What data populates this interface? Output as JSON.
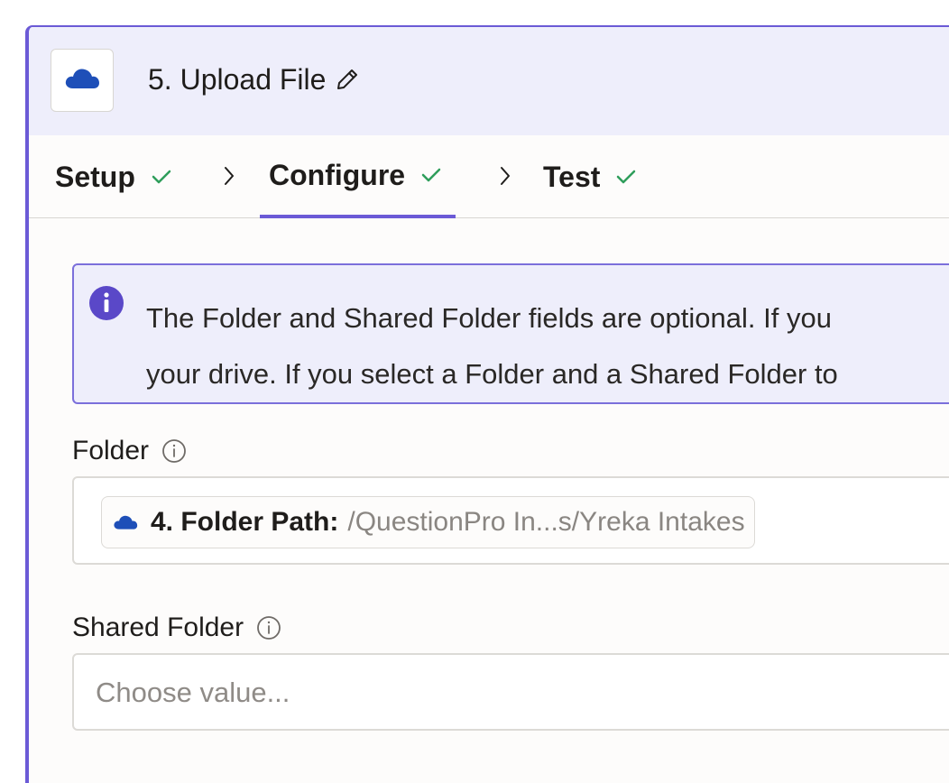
{
  "header": {
    "app_icon": "onedrive-cloud-icon",
    "step_title": "5. Upload File",
    "edit_icon": "pencil-icon"
  },
  "tabs": [
    {
      "label": "Setup",
      "status": "complete",
      "active": false
    },
    {
      "label": "Configure",
      "status": "complete",
      "active": true
    },
    {
      "label": "Test",
      "status": "complete",
      "active": false
    }
  ],
  "info_banner": {
    "icon": "info-circle-icon",
    "line1": "The Folder and Shared Folder fields are optional. If you",
    "line2": "your drive. If you select a Folder and a Shared Folder to"
  },
  "fields": {
    "folder": {
      "label": "Folder",
      "value_step": "4. Folder Path:",
      "value_text": "/QuestionPro In...s/Yreka Intakes"
    },
    "shared_folder": {
      "label": "Shared Folder",
      "placeholder": "Choose value..."
    }
  },
  "colors": {
    "accent": "#6b5ad6",
    "check_green": "#2f9e5b",
    "onedrive_blue": "#1e4fb8",
    "header_bg": "#eeeefb"
  }
}
